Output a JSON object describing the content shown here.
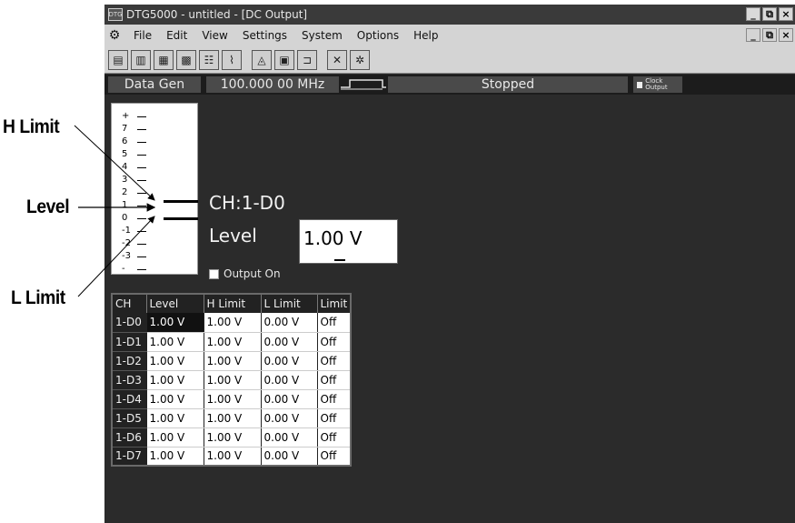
{
  "callouts": {
    "h_limit": "H Limit",
    "level": "Level",
    "l_limit": "L Limit"
  },
  "window": {
    "title": "DTG5000 - untitled - [DC Output]",
    "app_icon_text": "DTG"
  },
  "window_buttons": [
    "_",
    "⧉",
    "×"
  ],
  "menu": [
    "File",
    "Edit",
    "View",
    "Settings",
    "System",
    "Options",
    "Help"
  ],
  "statusbar": {
    "mode": "Data Gen",
    "frequency": "100.000 00 MHz",
    "state": "Stopped",
    "clock_output": "Clock Output"
  },
  "scale_labels": [
    "+",
    "7",
    "6",
    "5",
    "4",
    "3",
    "2",
    "1",
    "0",
    "-1",
    "-2",
    "-3",
    "-"
  ],
  "channel_display": {
    "channel": "CH:1-D0",
    "level_label": "Level",
    "level_value": "1.00 V",
    "output_on_label": "Output On",
    "output_on_checked": false
  },
  "table": {
    "headers": [
      "CH",
      "Level",
      "H Limit",
      "L Limit",
      "Limit"
    ],
    "rows": [
      [
        "1-D0",
        "1.00 V",
        "1.00 V",
        "0.00 V",
        "Off"
      ],
      [
        "1-D1",
        "1.00 V",
        "1.00 V",
        "0.00 V",
        "Off"
      ],
      [
        "1-D2",
        "1.00 V",
        "1.00 V",
        "0.00 V",
        "Off"
      ],
      [
        "1-D3",
        "1.00 V",
        "1.00 V",
        "0.00 V",
        "Off"
      ],
      [
        "1-D4",
        "1.00 V",
        "1.00 V",
        "0.00 V",
        "Off"
      ],
      [
        "1-D5",
        "1.00 V",
        "1.00 V",
        "0.00 V",
        "Off"
      ],
      [
        "1-D6",
        "1.00 V",
        "1.00 V",
        "0.00 V",
        "Off"
      ],
      [
        "1-D7",
        "1.00 V",
        "1.00 V",
        "0.00 V",
        "Off"
      ]
    ]
  }
}
